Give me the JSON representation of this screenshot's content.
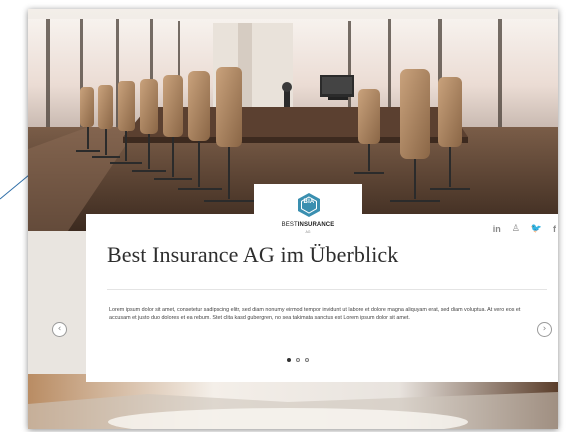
{
  "brand": {
    "logo_mark": "BIA",
    "name_part1": "BEST",
    "name_part2": "INSURANCE",
    "name_sub": "AG"
  },
  "social": [
    {
      "icon": "linkedin-icon",
      "glyph": "in"
    },
    {
      "icon": "xing-icon",
      "glyph": "♙"
    },
    {
      "icon": "twitter-icon",
      "glyph": "🐦"
    },
    {
      "icon": "facebook-icon",
      "glyph": "f"
    }
  ],
  "hero": {
    "title": "Best Insurance AG im Überblick",
    "body": "Lorem ipsum dolor sit amet, consetetur sadipscing elitr, sed diam nonumy eirmod tempor invidunt ut labore et dolore magna aliquyam erat, sed diam voluptua. At vero eos et accusam et justo duo dolores et ea rebum. Stet clita kasd gubergren, no sea takimata sanctus est Lorem ipsum dolor sit amet."
  },
  "carousel": {
    "prev_glyph": "‹",
    "next_glyph": "›",
    "slide_count": 3,
    "active_slide": 1
  },
  "colors": {
    "logo_teal": "#3a8fb0",
    "title_text": "#2e2e2e",
    "icon_grey": "#888888"
  }
}
